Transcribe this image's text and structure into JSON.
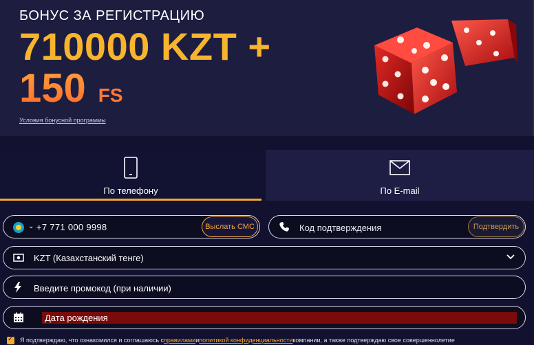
{
  "banner": {
    "title": "БОНУС ЗА РЕГИСТРАЦИЮ",
    "amount": "710000 KZT +",
    "freespins_count": "150",
    "freespins_unit": "FS",
    "conditions_link": "Условия бонусной программы"
  },
  "tabs": [
    {
      "label": "По телефону",
      "icon": "smartphone-icon",
      "active": true
    },
    {
      "label": "По E-mail",
      "icon": "envelope-icon",
      "active": false
    }
  ],
  "form": {
    "phone": {
      "country_icon": "kazakhstan-flag-icon",
      "value": "+7  771 000 9998",
      "send_sms_label": "Выслать СМС"
    },
    "code": {
      "placeholder": "Код подтверждения",
      "confirm_label": "Подтвердить"
    },
    "currency": {
      "value": "KZT (Казахстанский тенге)"
    },
    "promo": {
      "placeholder": "Введите промокод (при наличии)"
    },
    "birthdate": {
      "placeholder": "Дата рождения"
    }
  },
  "consent": {
    "checked": true,
    "text_before": "Я подтверждаю, что ознакомился и соглашаюсь с ",
    "rules_link": "правилами",
    "text_and": " и ",
    "privacy_link": "политикой конфиденциальности",
    "text_after": " компании, а также подтверждаю свое совершеннолетие"
  },
  "colors": {
    "accent": "#f7a72c",
    "background": "#121230",
    "banner_bg": "#1d1d40",
    "date_highlight": "#7a0b0b"
  }
}
